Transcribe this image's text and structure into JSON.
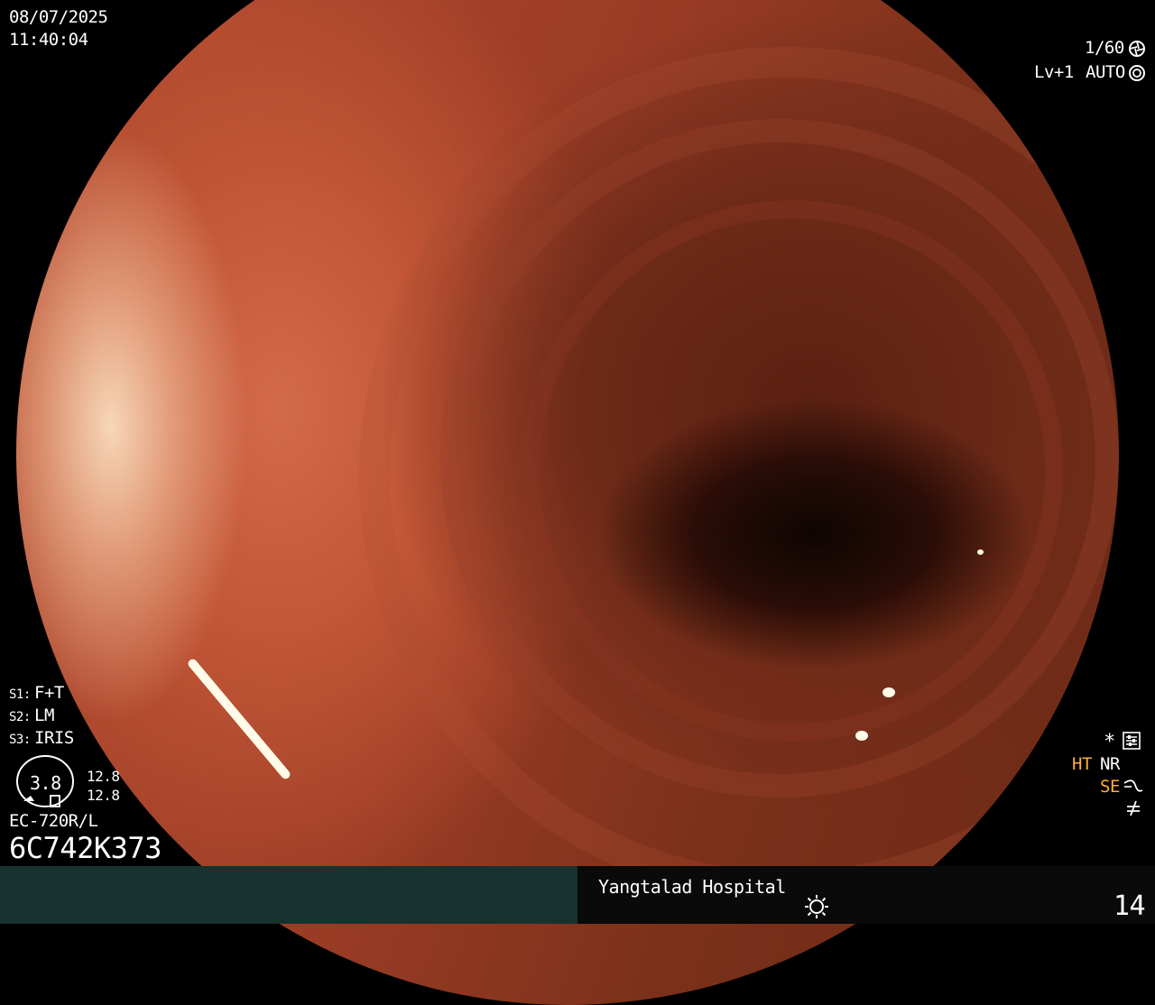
{
  "overlay": {
    "date": "08/07/2025",
    "time": "11:40:04",
    "shutter": "1/60",
    "level": "Lv+1",
    "iris_mode": "AUTO",
    "s1": "F+T",
    "s2": "LM",
    "s3": "IRIS",
    "s1_prefix": "S1:",
    "s2_prefix": "S2:",
    "s3_prefix": "S3:",
    "gauge_value": "3.8",
    "gauge_top": "12.8",
    "gauge_bottom": "12.8",
    "scope_model": "EC-720R/L",
    "serial": "6C742K373",
    "asterisk": "*",
    "ht_label": "HT",
    "nr_label": "NR",
    "se_label": "SE"
  },
  "footer": {
    "hospital": "Yangtalad Hospital",
    "frame_number": "14"
  },
  "icons": {
    "shutter": "aperture-icon",
    "iris": "iris-icon",
    "settings": "settings-sliders-icon",
    "se_curve": "curve-icon",
    "freeze": "not-equal-icon",
    "light": "light-bulb-icon",
    "gauge": "scope-orientation-gauge-icon"
  },
  "colors": {
    "footer_left": "#18322f",
    "footer_right": "#0a0a0a",
    "highlight_text": "#ffb02e"
  }
}
